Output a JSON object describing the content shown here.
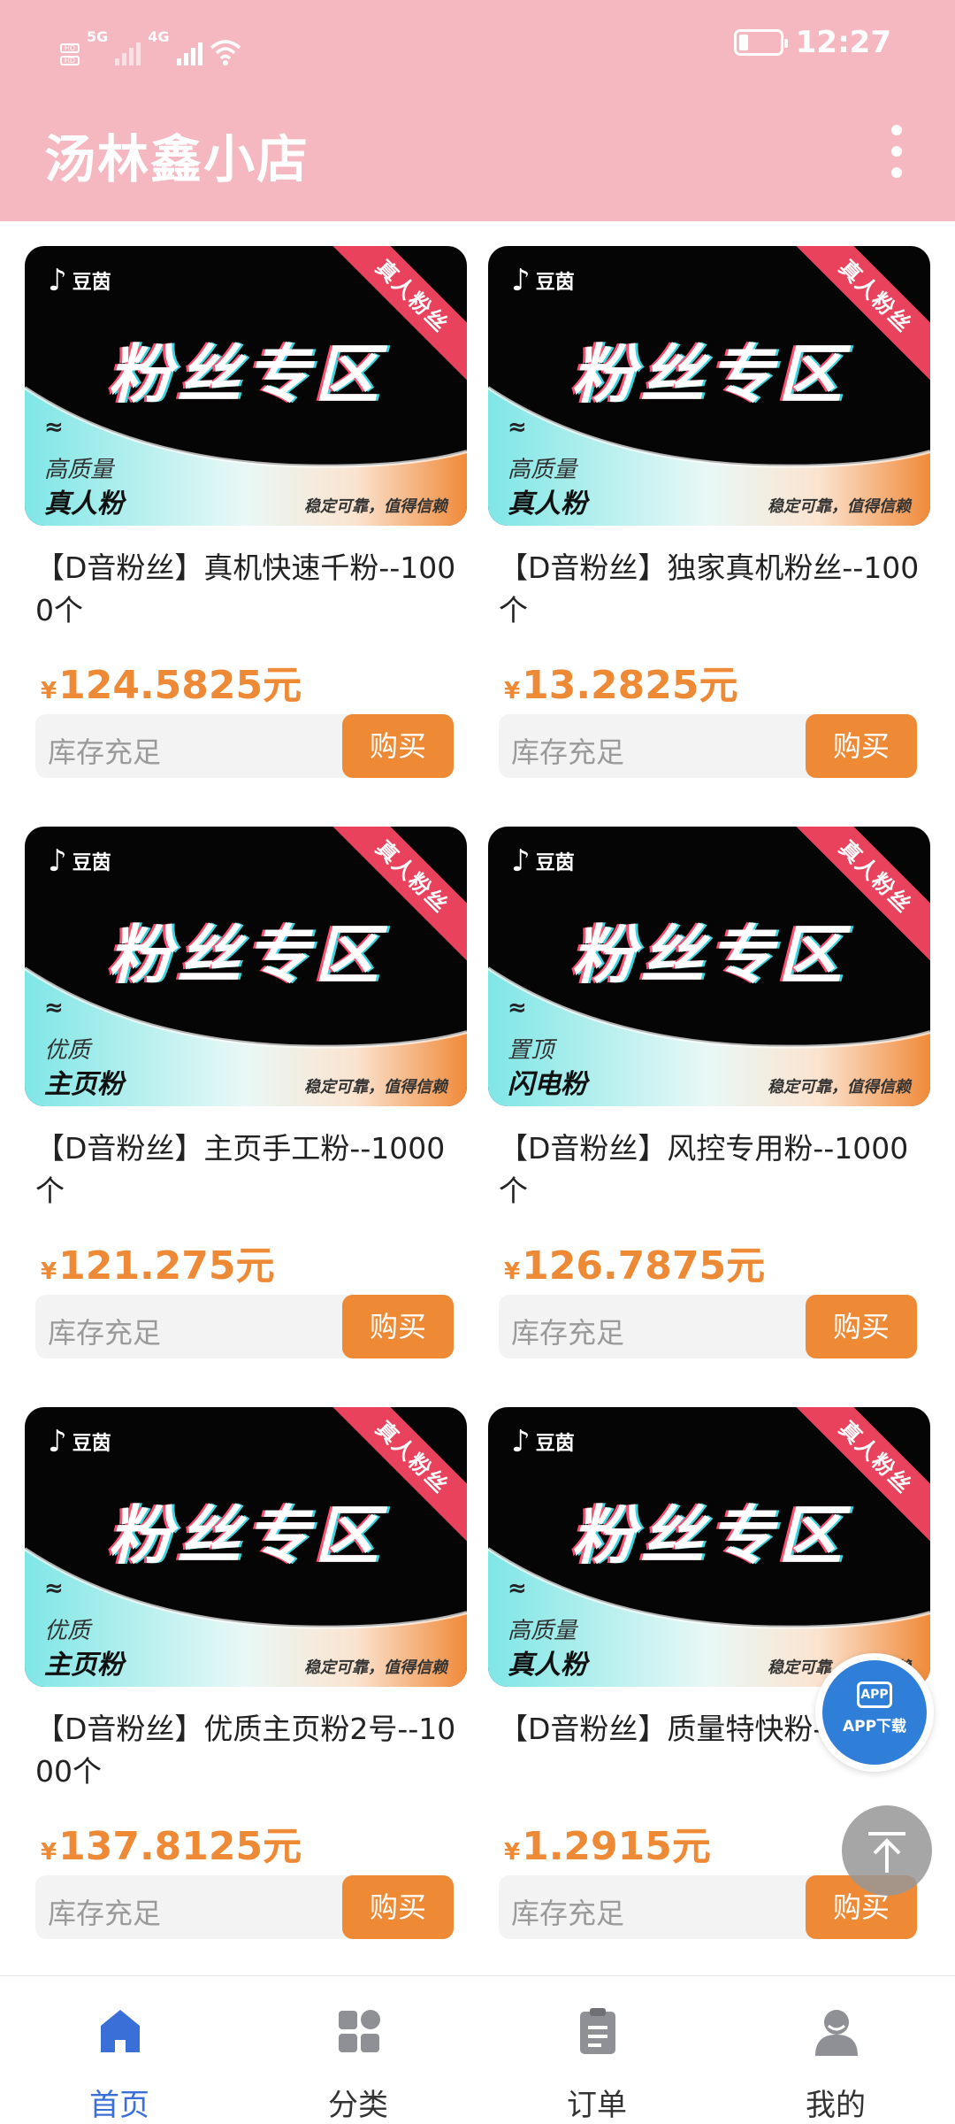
{
  "status_bar": {
    "network": "5G",
    "network2": "4G",
    "time": "12:27"
  },
  "header": {
    "title": "汤林鑫小店"
  },
  "products": [
    {
      "name": "【D音粉丝】真机快速千粉--1000个",
      "currency": "¥",
      "price": "124.5825元",
      "stock": "库存充足",
      "buy_label": "购买",
      "banner": {
        "brand": "豆茵",
        "zone": "粉丝专区",
        "ribbon": "真人粉丝",
        "wave": "≈",
        "tag_small": "高质量",
        "tag_big": "真人粉",
        "slogan": "稳定可靠，值得信赖"
      }
    },
    {
      "name": "【D音粉丝】独家真机粉丝--100个",
      "currency": "¥",
      "price": "13.2825元",
      "stock": "库存充足",
      "buy_label": "购买",
      "banner": {
        "brand": "豆茵",
        "zone": "粉丝专区",
        "ribbon": "真人粉丝",
        "wave": "≈",
        "tag_small": "高质量",
        "tag_big": "真人粉",
        "slogan": "稳定可靠，值得信赖"
      }
    },
    {
      "name": "【D音粉丝】主页手工粉--1000个",
      "currency": "¥",
      "price": "121.275元",
      "stock": "库存充足",
      "buy_label": "购买",
      "banner": {
        "brand": "豆茵",
        "zone": "粉丝专区",
        "ribbon": "真人粉丝",
        "wave": "≈",
        "tag_small": "优质",
        "tag_big": "主页粉",
        "slogan": "稳定可靠，值得信赖"
      }
    },
    {
      "name": "【D音粉丝】风控专用粉--1000个",
      "currency": "¥",
      "price": "126.7875元",
      "stock": "库存充足",
      "buy_label": "购买",
      "banner": {
        "brand": "豆茵",
        "zone": "粉丝专区",
        "ribbon": "真人粉丝",
        "wave": "≈",
        "tag_small": "置顶",
        "tag_big": "闪电粉",
        "slogan": "稳定可靠，值得信赖"
      }
    },
    {
      "name": "【D音粉丝】优质主页粉2号--1000个",
      "currency": "¥",
      "price": "137.8125元",
      "stock": "库存充足",
      "buy_label": "购买",
      "banner": {
        "brand": "豆茵",
        "zone": "粉丝专区",
        "ribbon": "真人粉丝",
        "wave": "≈",
        "tag_small": "优质",
        "tag_big": "主页粉",
        "slogan": "稳定可靠，值得信赖"
      }
    },
    {
      "name": "【D音粉丝】质量特快粉--10个",
      "currency": "¥",
      "price": "1.2915元",
      "stock": "库存充足",
      "buy_label": "购买",
      "banner": {
        "brand": "豆茵",
        "zone": "粉丝专区",
        "ribbon": "真人粉丝",
        "wave": "≈",
        "tag_small": "高质量",
        "tag_big": "真人粉",
        "slogan": "稳定可靠，值得信赖"
      }
    }
  ],
  "floating": {
    "app_icon": "APP",
    "app_label": "APP下载"
  },
  "nav": {
    "home": "首页",
    "category": "分类",
    "orders": "订单",
    "mine": "我的"
  },
  "colors": {
    "header": "#f5b8c0",
    "accent": "#ee8a36",
    "nav_active": "#3b6fd8"
  }
}
